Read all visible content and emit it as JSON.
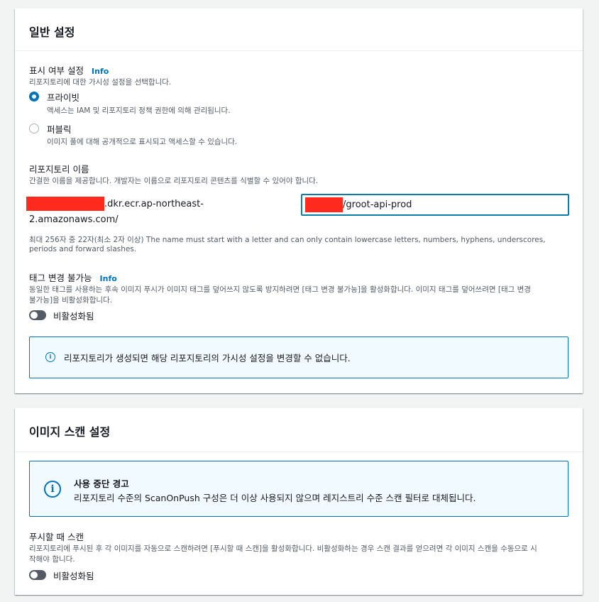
{
  "general": {
    "title": "일반 설정",
    "visibility": {
      "label": "표시 여부 설정",
      "info": "Info",
      "desc": "리포지토리에 대한 가시성 설정을 선택합니다.",
      "options": [
        {
          "label": "프라이빗",
          "desc": "액세스는 IAM 및 리포지토리 정책 권한에 의해 관리됩니다.",
          "selected": true
        },
        {
          "label": "퍼블릭",
          "desc": "이미지 풀에 대해 공개적으로 표시되고 액세스할 수 있습니다.",
          "selected": false
        }
      ]
    },
    "repo_name": {
      "label": "리포지토리 이름",
      "desc": "간결한 이름을 제공합니다. 개발자는 이름으로 리포지토리 콘텐츠를 식별할 수 있어야 합니다.",
      "prefix_line1": ".dkr.ecr.ap-northeast-",
      "prefix_line2": "2.amazonaws.com/",
      "value": "/groot-api-prod",
      "constraint_line1": "최대 256자 중 22자(최소 2자 이상) The name must start with a letter and can only contain lowercase letters, numbers, hyphens, underscores,",
      "constraint_line2": "periods and forward slashes."
    },
    "tag_immutability": {
      "label": "태그 변경 불가능",
      "info": "Info",
      "desc_line1": "동일한 태그를 사용하는 후속 이미지 푸시가 이미지 태그를 덮어쓰지 않도록 방지하려면 [태그 변경 불가능]을 활성화합니다. 이미지 태그를 덮어쓰려면 [태그 변경",
      "desc_line2": "불가능]을 비활성화합니다.",
      "toggle_label": "비활성화됨",
      "enabled": false
    },
    "alert_text": "리포지토리가 생성되면 해당 리포지토리의 가시성 설정을 변경할 수 없습니다."
  },
  "scan": {
    "title": "이미지 스캔 설정",
    "warning": {
      "title": "사용 중단 경고",
      "text": "리포지토리 수준의 ScanOnPush 구성은 더 이상 사용되지 않으며 레지스트리 수준 스캔 필터로 대체됩니다."
    },
    "scan_on_push": {
      "label": "푸시할 때 스캔",
      "desc_line1": "리포지토리에 푸시된 후 각 이미지를 자동으로 스캔하려면 [푸시할 때 스캔]을 활성화합니다. 비활성화하는 경우 스캔 결과를 얻으려면 각 이미지 스캔을 수동으로 시",
      "desc_line2": "작해야 합니다.",
      "toggle_label": "비활성화됨",
      "enabled": false
    }
  },
  "icons": {
    "info": "info-circle-icon",
    "redaction": "redacted-block"
  },
  "colors": {
    "accent": "#0073bb",
    "redaction": "#ff2a1e",
    "alert_bg": "#f1faff"
  }
}
